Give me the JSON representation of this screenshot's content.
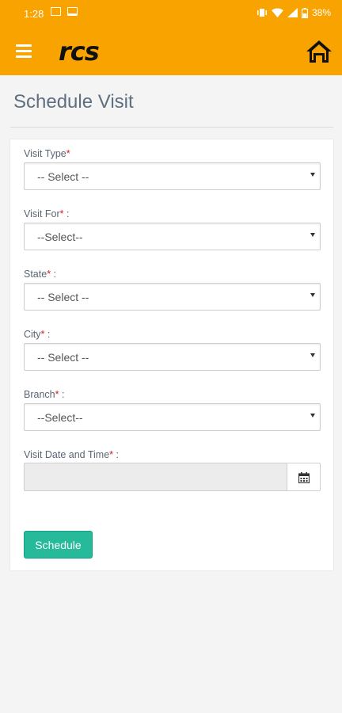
{
  "status_bar": {
    "time": "1:28",
    "battery": "38%",
    "icons": [
      "image-icon",
      "desktop-icon",
      "vibrate-icon",
      "wifi-icon",
      "signal-icon",
      "battery-icon"
    ]
  },
  "app_bar": {
    "logo_text": "rcs",
    "icons": [
      "menu-icon",
      "home-icon"
    ]
  },
  "page": {
    "title": "Schedule Visit"
  },
  "form": {
    "fields": [
      {
        "label": "Visit Type",
        "required_mark": "*",
        "suffix": "",
        "value": "-- Select --"
      },
      {
        "label": "Visit For",
        "required_mark": "*",
        "suffix": " :",
        "value": "--Select--"
      },
      {
        "label": "State",
        "required_mark": "*",
        "suffix": " :",
        "value": "-- Select --"
      },
      {
        "label": "City",
        "required_mark": "*",
        "suffix": " :",
        "value": "-- Select --"
      },
      {
        "label": "Branch",
        "required_mark": "*",
        "suffix": " :",
        "value": "--Select--"
      }
    ],
    "datetime": {
      "label": "Visit Date and Time",
      "required_mark": "*",
      "suffix": " :",
      "value": "",
      "icon": "calendar-icon"
    },
    "submit_label": "Schedule"
  },
  "colors": {
    "app_bar": "#f9a300",
    "primary_button": "#26b99a",
    "required": "#cc1f1f",
    "title": "#5f6f80"
  }
}
